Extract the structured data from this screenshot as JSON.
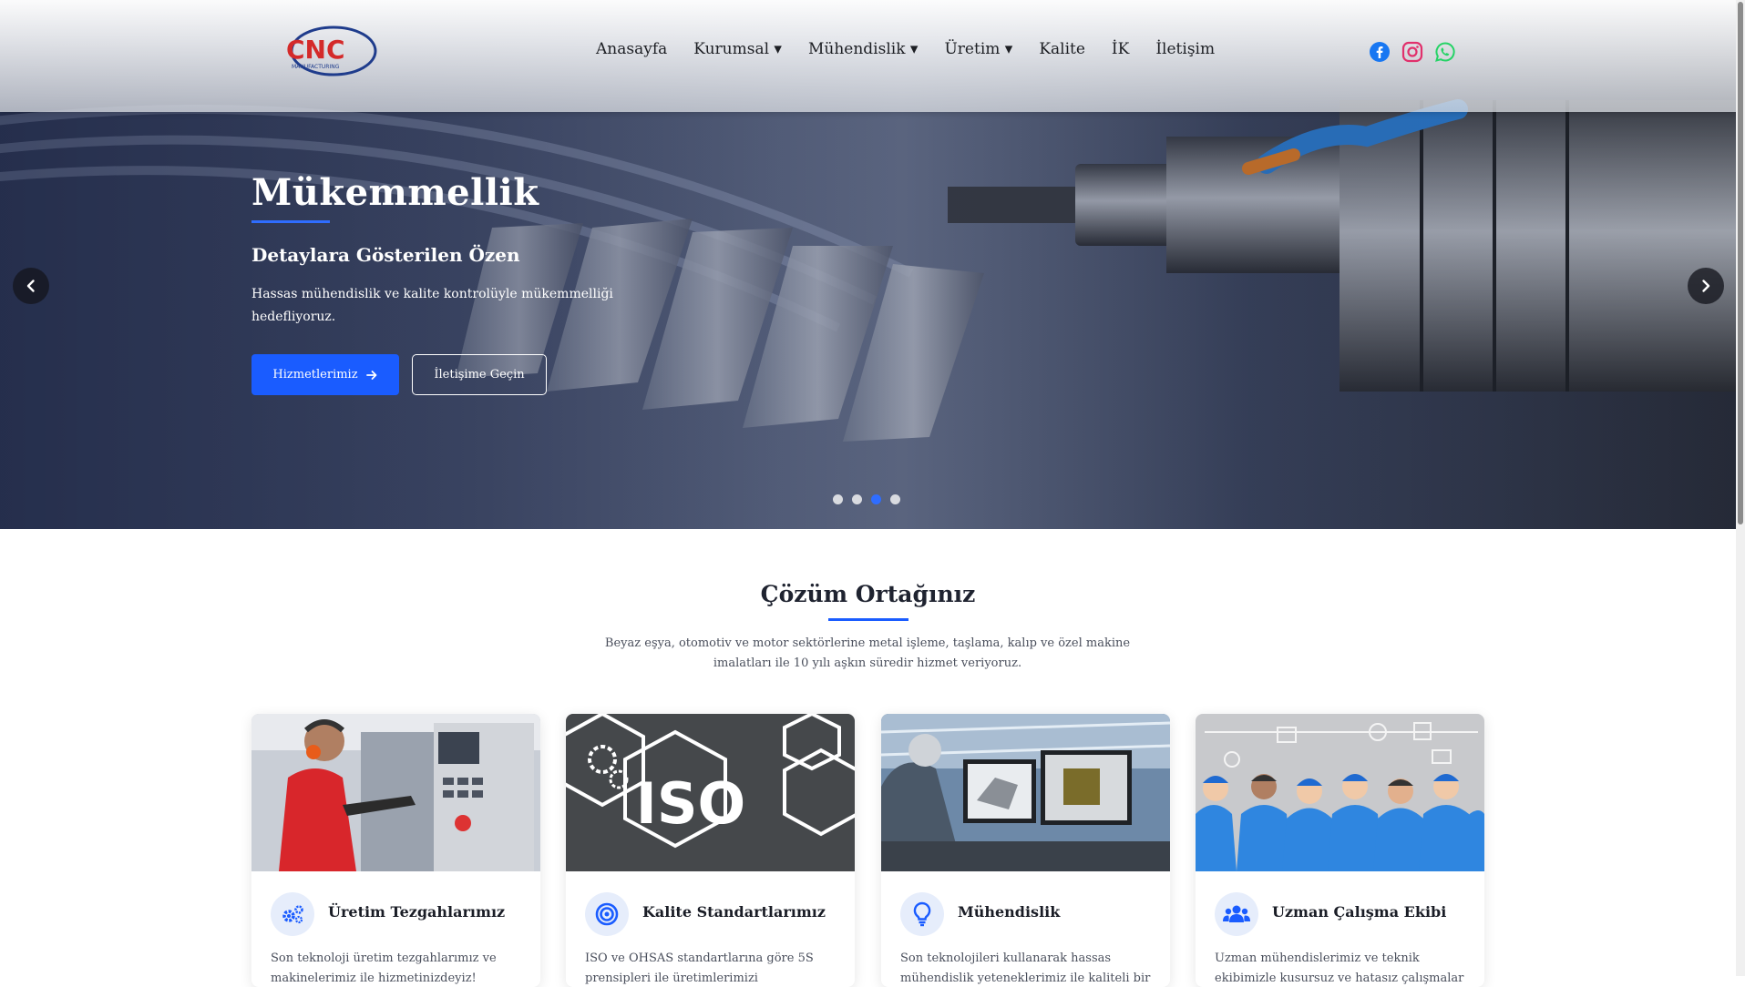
{
  "header": {
    "logo_text": "CNC",
    "logo_subtext": "MANUFACTURING",
    "nav": [
      "Anasayfa",
      "Kurumsal ▾",
      "Mühendislik ▾",
      "Üretim ▾",
      "Kalite",
      "İK",
      "İletişim"
    ],
    "social": [
      "facebook-icon",
      "instagram-icon",
      "whatsapp-icon"
    ]
  },
  "hero": {
    "title": "Mükemmellik",
    "subtitle": "Detaylara Gösterilen Özen",
    "description": "Hassas mühendislik ve kalite kontrolüyle mükemmelliği hedefliyoruz.",
    "primary_button": "Hizmetlerimiz",
    "secondary_button": "İletişime Geçin",
    "slides": 4,
    "active_slide": 3
  },
  "section": {
    "title": "Çözüm Ortağınız",
    "description": "Beyaz eşya, otomotiv ve motor sektörlerine metal işleme, taşlama, kalıp ve özel makine imalatları ile 10 yılı aşkın süredir hizmet veriyoruz."
  },
  "cards": [
    {
      "title": "Üretim Tezgahlarımız",
      "desc": "Son teknoloji üretim tezgahlarımız ve makinelerimiz ile hizmetinizdeyiz!",
      "icon": "gears-icon"
    },
    {
      "title": "Kalite Standartlarımız",
      "desc": "ISO ve OHSAS standartlarına göre 5S prensipleri ile üretimlerimizi",
      "icon": "target-icon",
      "image_text": "ISO"
    },
    {
      "title": "Mühendislik",
      "desc": "Son teknolojileri kullanarak hassas mühendislik yeteneklerimiz ile kaliteli bir",
      "icon": "lightbulb-icon"
    },
    {
      "title": "Uzman Çalışma Ekibi",
      "desc": "Uzman mühendislerimiz ve teknik ekibimizle kusursuz ve hatasız çalışmalar üretmekteyiz.",
      "icon": "users-icon"
    }
  ],
  "colors": {
    "accent": "#1a5cff",
    "dot_active": "#2f6dff",
    "icon_bg": "#e6edfb"
  }
}
